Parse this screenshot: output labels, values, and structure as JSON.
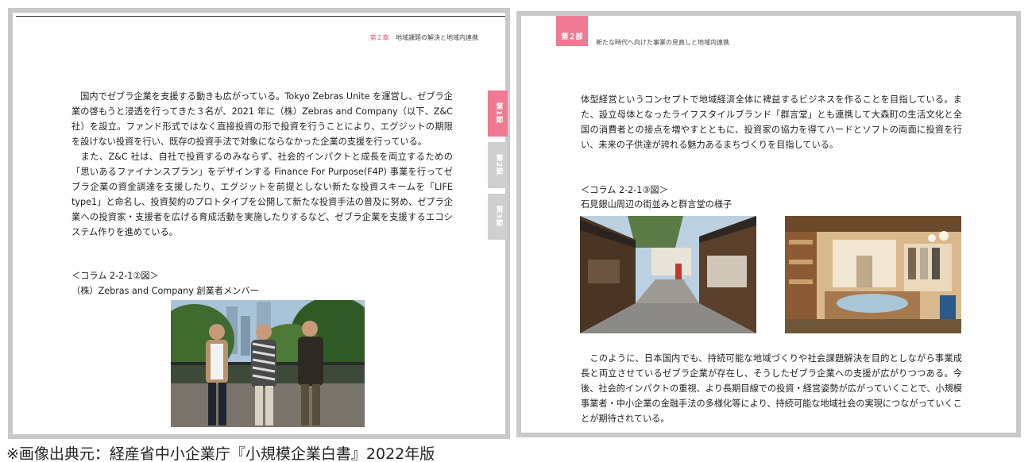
{
  "left_page": {
    "header": {
      "chapter": "第２章",
      "title": "地域課題の解決と地域内連携"
    },
    "side_tabs": [
      {
        "label": "第1節",
        "active": true
      },
      {
        "label": "第2節",
        "active": false
      },
      {
        "label": "第3節",
        "active": false
      }
    ],
    "body": "　国内でゼブラ企業を支援する動きも広がっている。Tokyo Zebras Unite を運営し、ゼブラ企業の啓もうと浸透を行ってきた３名が、2021 年に（株）Zebras and Company（以下、Z&C 社）を設立。ファンド形式ではなく直接投資の形で投資を行うことにより、エグジットの期限を設けない投資を行い、既存の投資手法で対象にならなかった企業の支援を行っている。\n　また、Z&C 社は、自社で投資するのみならず、社会的インパクトと成長を両立するための「思いあるファイナンスプラン」をデザインする Finance For Purpose(F4P) 事業を行ってゼブラ企業の資金調達を支援したり、エグジットを前提としない新たな投資スキームを「LIFE type1」と命名し、投資契約のプロトタイプを公開して新たな投資手法の普及に努め、ゼブラ企業への投資家・支援者を広げる育成活動を実施したりするなど、ゼブラ企業を支援するエコシステム作りを進めている。",
    "figure_label": "＜コラム 2-2-1②図＞",
    "figure_caption": "（株）Zebras and Company 創業者メンバー"
  },
  "right_page": {
    "header": {
      "part": "第２部",
      "title": "新たな時代へ向けた事業の見直しと地域内連携"
    },
    "body_top": "体型経営というコンセプトで地域経済全体に裨益するビジネスを作ることを目指している。また、設立母体となったライフスタイルブランド「群言堂」とも連携して大森町の生活文化と全国の消費者との接点を増やすとともに、投資家の協力を得てハードとソフトの両面に投資を行い、未来の子供達が誇れる魅力あるまちづくりを目指している。",
    "figure_label": "＜コラム 2-2-1③図＞",
    "figure_caption": "石見銀山周辺の街並みと群言堂の様子",
    "body_bottom": "　このように、日本国内でも、持続可能な地域づくりや社会課題解決を目的としながら事業成長と両立させているゼブラ企業が存在し、そうしたゼブラ企業への支援が広がりつつある。今後、社会的インパクトの重視、より長期目線での投資・経営姿勢が広がっていくことで、小規模事業者・中小企業の金融手法の多様化等により、持続可能な地域社会の実現につながっていくことが期待されている。"
  },
  "source_note": "※画像出典元：経産省中小企業庁『小規模企業白書』2022年版"
}
